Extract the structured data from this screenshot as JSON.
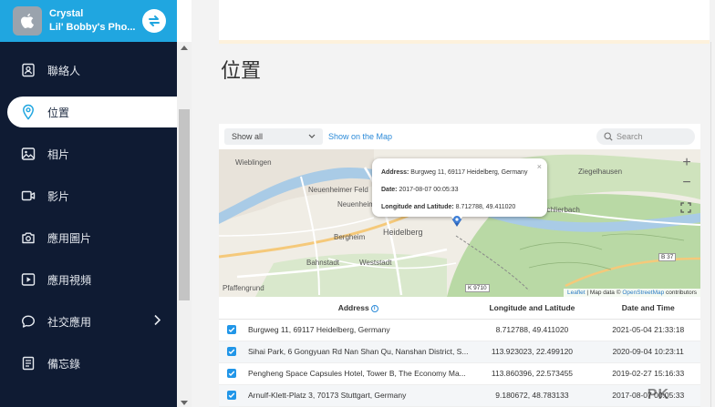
{
  "device": {
    "owner": "Crystal",
    "model": "Lil' Bobby's Pho..."
  },
  "sidebar": {
    "items": [
      {
        "label": "聯絡人",
        "icon": "contacts-icon"
      },
      {
        "label": "位置",
        "icon": "location-pin-icon",
        "active": true
      },
      {
        "label": "相片",
        "icon": "photo-icon"
      },
      {
        "label": "影片",
        "icon": "video-icon"
      },
      {
        "label": "應用圖片",
        "icon": "camera-icon"
      },
      {
        "label": "應用視頻",
        "icon": "play-icon"
      },
      {
        "label": "社交應用",
        "icon": "chat-icon",
        "has_submenu": true
      },
      {
        "label": "備忘錄",
        "icon": "notes-icon"
      }
    ]
  },
  "main": {
    "title": "位置",
    "toolbar": {
      "filter_value": "Show all",
      "map_link": "Show on the Map",
      "search_placeholder": "Search"
    },
    "map": {
      "places": [
        "Wieblingen",
        "Neuenheimer Feld",
        "Neuenheim",
        "Bergheim",
        "Heidelberg",
        "Bahnstadt",
        "Weststadt",
        "Pfaffengrund",
        "Ziegelhausen",
        "Schlierbach"
      ],
      "road_labels": [
        "K 9710",
        "B 37"
      ],
      "popup": {
        "address_label": "Address:",
        "address": "Burgweg 11, 69117 Heidelberg, Germany",
        "date_label": "Date:",
        "date": "2017-08-07 00:05:33",
        "coords_label": "Longitude and Latitude:",
        "coords": "8.712788, 49.411020",
        "close": "×"
      },
      "zoom_in": "+",
      "zoom_out": "−",
      "attribution": {
        "leaflet": "Leaflet",
        "sep": " | Map data © ",
        "osm": "OpenStreetMap",
        "suffix": " contributors"
      }
    },
    "table": {
      "headers": {
        "address": "Address",
        "coords": "Longitude and Latitude",
        "date": "Date and Time"
      },
      "rows": [
        {
          "address": "Burgweg 11, 69117 Heidelberg, Germany",
          "coords": "8.712788, 49.411020",
          "date": "2021-05-04 21:33:18"
        },
        {
          "address": "Sihai Park, 6 Gongyuan Rd Nan Shan Qu, Nanshan District, S...",
          "coords": "113.923023, 22.499120",
          "date": "2020-09-04 10:23:11"
        },
        {
          "address": "Pengheng Space Capsules Hotel, Tower B, The Economy Ma...",
          "coords": "113.860396, 22.573455",
          "date": "2019-02-27 15:16:33"
        },
        {
          "address": "Arnulf-Klett-Platz 3, 70173 Stuttgart, Germany",
          "coords": "9.180672, 48.783133",
          "date": "2017-08-07 00:05:33"
        }
      ]
    }
  },
  "watermark": "PK",
  "colors": {
    "sidebar_bg": "#0f1b33",
    "device_header": "#20a6e0",
    "accent": "#2196e8",
    "link": "#2b8ad8"
  }
}
